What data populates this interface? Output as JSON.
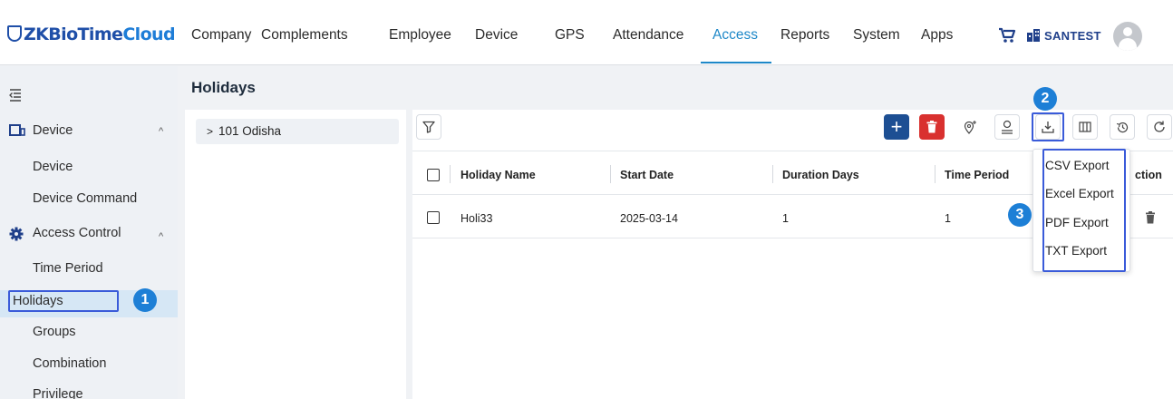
{
  "app": {
    "logo_main": "ZKBioTime",
    "logo_accent": "Cloud"
  },
  "nav": {
    "items": [
      {
        "label": "Company",
        "active": false
      },
      {
        "label": "Complements",
        "active": false
      },
      {
        "label": "Employee",
        "active": false
      },
      {
        "label": "Device",
        "active": false
      },
      {
        "label": "GPS",
        "active": false
      },
      {
        "label": "Attendance",
        "active": false
      },
      {
        "label": "Access",
        "active": true
      },
      {
        "label": "Reports",
        "active": false
      },
      {
        "label": "System",
        "active": false
      },
      {
        "label": "Apps",
        "active": false
      }
    ],
    "company": "SANTEST"
  },
  "sidebar": {
    "groups": [
      {
        "label": "Device",
        "icon": "device-icon",
        "items": [
          "Device",
          "Device Command"
        ]
      },
      {
        "label": "Access Control",
        "icon": "gear-icon",
        "items": [
          "Time Period",
          "Holidays",
          "Groups",
          "Combination",
          "Privilege"
        ]
      }
    ],
    "active_item": "Holidays"
  },
  "page": {
    "title": "Holidays"
  },
  "tree": {
    "items": [
      {
        "label": "101 Odisha"
      }
    ]
  },
  "table": {
    "columns": [
      "Holiday Name",
      "Start Date",
      "Duration Days",
      "Time Period",
      "Action"
    ],
    "visible_action_header": "ction",
    "rows": [
      {
        "name": "Holi33",
        "start_date": "2025-03-14",
        "duration_days": "1",
        "time_period": "1"
      }
    ]
  },
  "toolbar": {
    "add_label": "+",
    "icons": [
      "filter-icon",
      "add-icon",
      "delete-icon",
      "location-icon",
      "user-icon",
      "download-icon",
      "columns-icon",
      "history-icon",
      "refresh-icon"
    ]
  },
  "export_menu": {
    "items": [
      "CSV Export",
      "Excel Export",
      "PDF Export",
      "TXT Export"
    ]
  },
  "steps": [
    "1",
    "2",
    "3"
  ],
  "colors": {
    "brand": "#1f4fa8",
    "accent": "#1e88c8",
    "add_button": "#1d4f93",
    "delete_button": "#d9312f",
    "step_badge": "#1d7fd6",
    "highlight": "#3a5bd9"
  }
}
